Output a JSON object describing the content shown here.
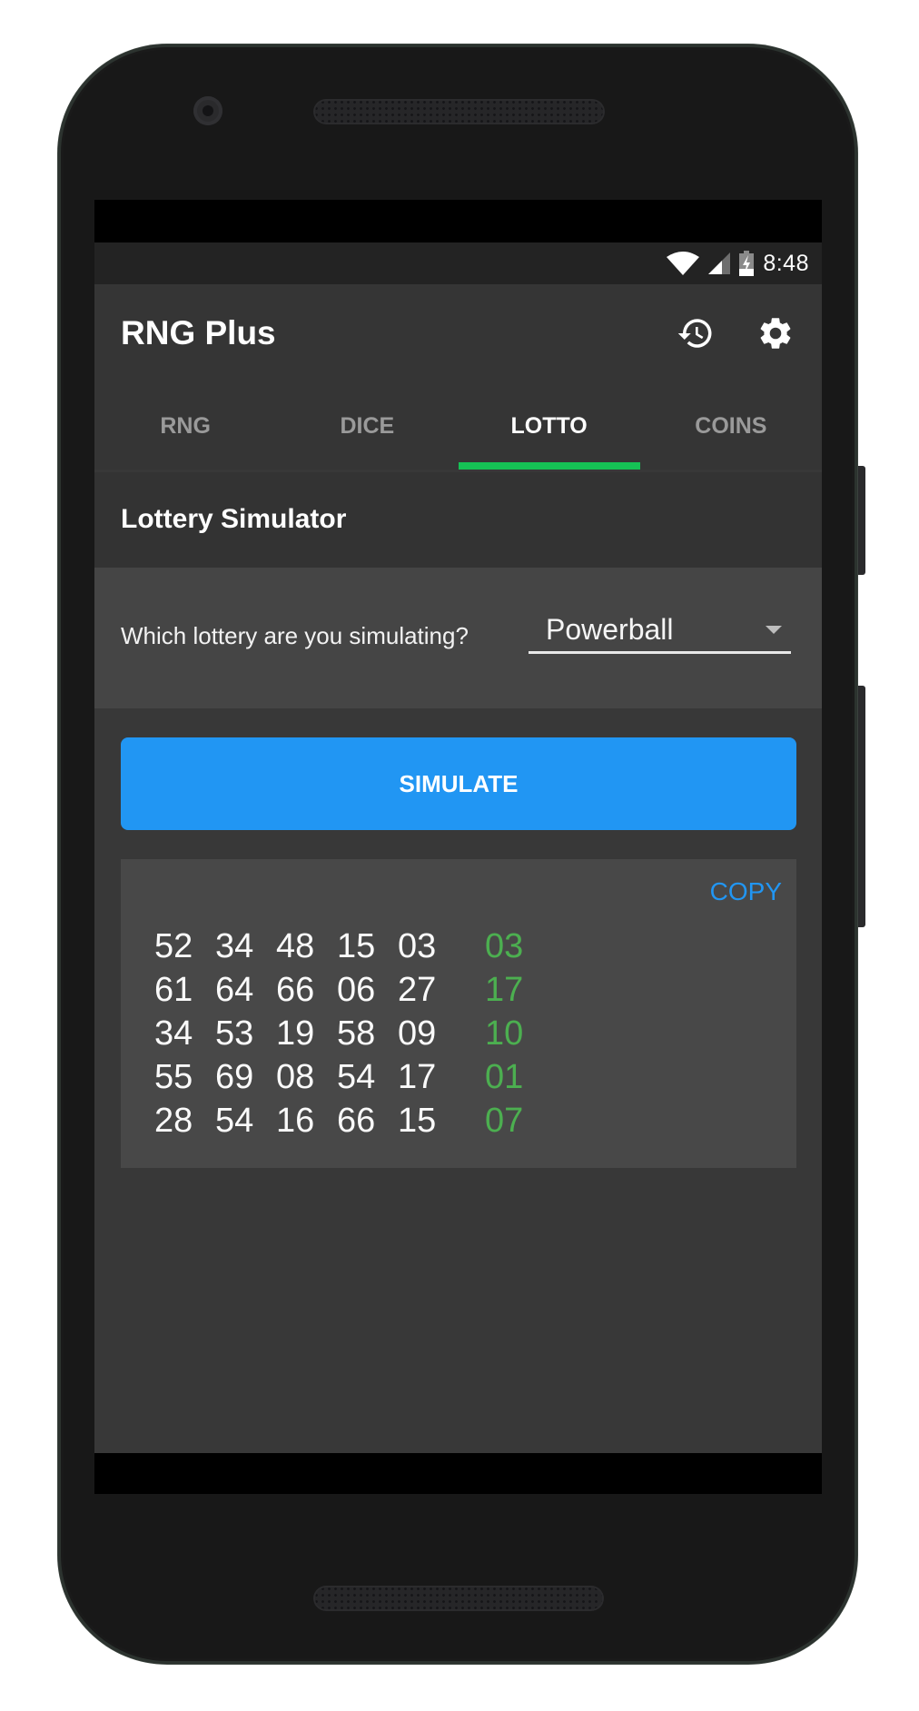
{
  "status_bar": {
    "time": "8:48",
    "icons": [
      "wifi-icon",
      "signal-icon",
      "battery-charging-icon"
    ]
  },
  "app_bar": {
    "title": "RNG Plus",
    "actions": [
      "history-icon",
      "settings-icon"
    ]
  },
  "tabs": [
    {
      "label": "RNG",
      "active": false
    },
    {
      "label": "DICE",
      "active": false
    },
    {
      "label": "LOTTO",
      "active": true
    },
    {
      "label": "COINS",
      "active": false
    }
  ],
  "colors": {
    "accent_tab": "#15c255",
    "primary_button": "#2196f3",
    "bonus_number": "#4caf50",
    "copy_link": "#2196f3"
  },
  "section": {
    "title": "Lottery Simulator"
  },
  "selector": {
    "label": "Which lottery are you simulating?",
    "selected": "Powerball"
  },
  "simulate_button": {
    "label": "SIMULATE"
  },
  "results": {
    "copy_label": "COPY",
    "rows": [
      {
        "numbers": [
          "52",
          "34",
          "48",
          "15",
          "03"
        ],
        "bonus": "03"
      },
      {
        "numbers": [
          "61",
          "64",
          "66",
          "06",
          "27"
        ],
        "bonus": "17"
      },
      {
        "numbers": [
          "34",
          "53",
          "19",
          "58",
          "09"
        ],
        "bonus": "10"
      },
      {
        "numbers": [
          "55",
          "69",
          "08",
          "54",
          "17"
        ],
        "bonus": "01"
      },
      {
        "numbers": [
          "28",
          "54",
          "16",
          "66",
          "15"
        ],
        "bonus": "07"
      }
    ]
  }
}
